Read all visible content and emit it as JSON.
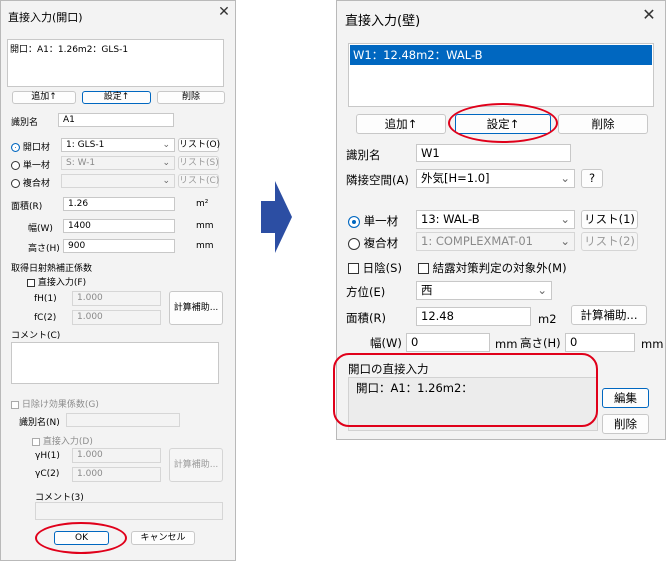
{
  "left": {
    "title": "直接入力(開口)",
    "list_item": "開口：A1：1.26m2：GLS-1",
    "add_btn": "追加↑",
    "set_btn": "設定↑",
    "del_btn": "削除",
    "id_label": "識別名",
    "id_value": "A1",
    "opening_label": "開口材",
    "opening_value": "1: GLS-1",
    "list_o": "リスト(O)",
    "single_label": "単一材",
    "single_value": "S: W-1",
    "list_s": "リスト(S)",
    "composite_label": "複合材",
    "list_c": "リスト(C)",
    "area_label": "面積(R)",
    "area_value": "1.26",
    "area_unit": "m²",
    "width_label": "幅(W)",
    "width_value": "1400",
    "width_unit": "mm",
    "height_label": "高さ(H)",
    "height_value": "900",
    "height_unit": "mm",
    "solar_label": "取得日射熱補正係数",
    "direct_f": "直接入力(F)",
    "fh_label": "fH(1)",
    "fh_value": "1.000",
    "fc_label": "fC(2)",
    "fc_value": "1.000",
    "calc_btn": "計算補助...",
    "comment_label": "コメント(C)",
    "shade_label": "日除け効果係数(G)",
    "id2_label": "識別名(N)",
    "direct_d": "直接入力(D)",
    "gh_label": "γH(1)",
    "gh_value": "1.000",
    "gc_label": "γC(2)",
    "gc_value": "1.000",
    "calc_btn2": "計算補助...",
    "comment3_label": "コメント(3)",
    "ok_btn": "OK",
    "cancel_btn": "キャンセル"
  },
  "right": {
    "title": "直接入力(壁)",
    "list_item": "W1：12.48m2：WAL-B",
    "add_btn": "追加↑",
    "set_btn": "設定↑",
    "del_btn": "削除",
    "id_label": "識別名",
    "id_value": "W1",
    "adjacent_label": "隣接空間(A)",
    "adjacent_value": "外気[H=1.0]",
    "help_btn": "?",
    "single_label": "単一材",
    "single_value": "13: WAL-B",
    "list1_btn": "リスト(1)",
    "composite_label": "複合材",
    "composite_value": "1: COMPLEXMAT-01",
    "list2_btn": "リスト(2)",
    "shade_label": "日陰(S)",
    "condensation_label": "結露対策判定の対象外(M)",
    "orientation_label": "方位(E)",
    "orientation_value": "西",
    "area_label": "面積(R)",
    "area_value": "12.48",
    "area_unit": "m2",
    "calc_btn": "計算補助...",
    "width_label": "幅(W)",
    "width_value": "0",
    "width_unit": "mm",
    "height_label": "高さ(H)",
    "height_value": "0",
    "height_unit": "mm",
    "direct_header": "開口の直接入力",
    "direct_item": "開口：A1：1.26m2：",
    "edit_btn": "編集",
    "del2_btn": "削除"
  },
  "colors": {
    "accent": "#0067c0",
    "annotation": "#e0001a",
    "arrow": "#2c4ea3"
  },
  "icons": {
    "close": "close-icon",
    "arrow": "right-arrow-icon"
  }
}
